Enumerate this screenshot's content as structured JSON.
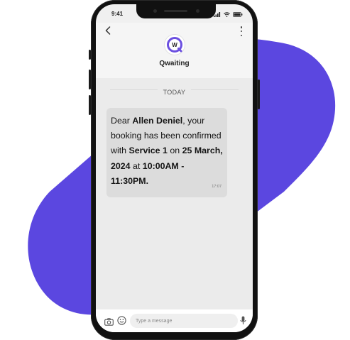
{
  "colors": {
    "accent_blob": "#5b47e0",
    "brand_purple": "#6b4fe0",
    "bubble_bg": "#dcdcdc",
    "chat_bg": "#ebebeb"
  },
  "status_bar": {
    "time": "9:41",
    "icons": [
      "signal-icon",
      "wifi-icon",
      "battery-icon"
    ]
  },
  "header": {
    "back_icon": "chevron-left-icon",
    "more_icon": "more-vertical-icon",
    "avatar_letter": "W",
    "contact_name": "Qwaiting"
  },
  "chat": {
    "date_label": "TODAY",
    "message": {
      "parts": [
        {
          "text": "Dear ",
          "bold": false
        },
        {
          "text": "Allen Deniel",
          "bold": true
        },
        {
          "text": ", your booking has been confirmed with ",
          "bold": false
        },
        {
          "text": "Service 1",
          "bold": true
        },
        {
          "text": " on ",
          "bold": false
        },
        {
          "text": "25 March, 2024",
          "bold": true
        },
        {
          "text": " at ",
          "bold": false
        },
        {
          "text": "10:00AM - 11:30PM.",
          "bold": true
        }
      ],
      "time": "17:07"
    }
  },
  "composer": {
    "placeholder": "Type a message",
    "value": "",
    "icons": [
      "camera-icon",
      "emoji-icon",
      "mic-icon"
    ]
  }
}
